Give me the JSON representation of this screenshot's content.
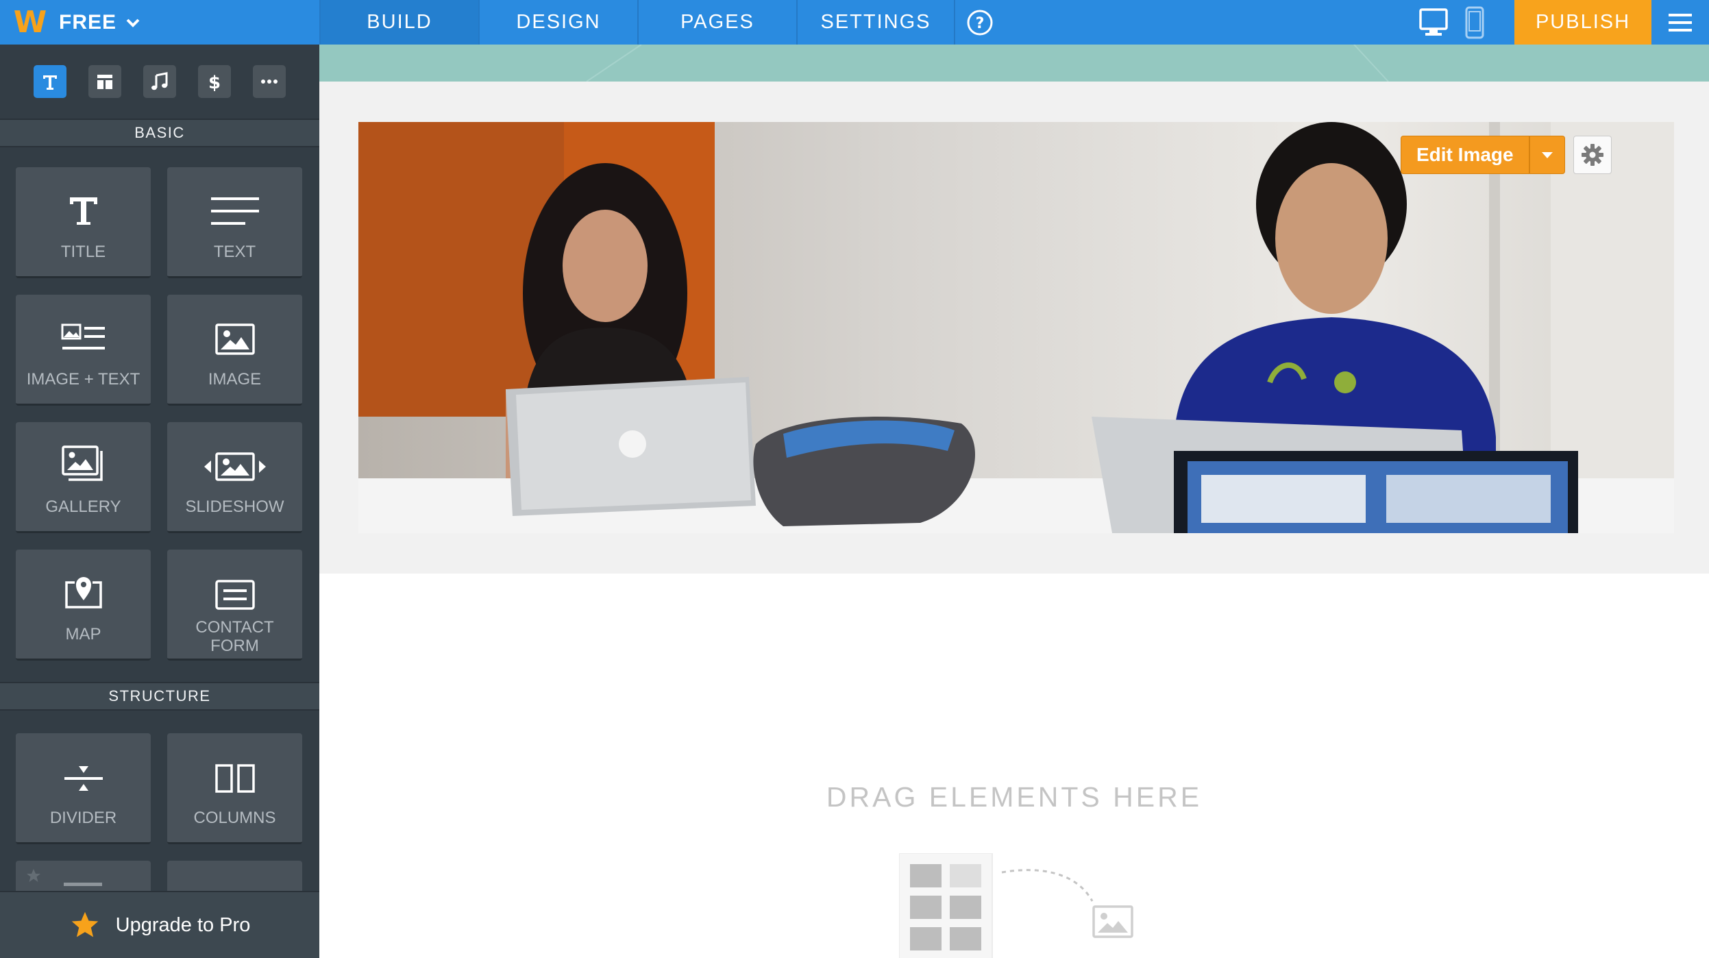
{
  "topbar": {
    "logo_letter": "W",
    "plan_label": "FREE",
    "tabs": [
      {
        "label": "BUILD",
        "active": true
      },
      {
        "label": "DESIGN",
        "active": false
      },
      {
        "label": "PAGES",
        "active": false
      },
      {
        "label": "SETTINGS",
        "active": false
      }
    ],
    "help_icon": "question-circle-icon",
    "publish_label": "PUBLISH"
  },
  "sidebar": {
    "categories": [
      "text-icon",
      "layout-icon",
      "music-icon",
      "dollar-icon",
      "more-icon"
    ],
    "basic_header": "BASIC",
    "basic_items": [
      {
        "label": "TITLE",
        "icon": "title-icon"
      },
      {
        "label": "TEXT",
        "icon": "text-lines-icon"
      },
      {
        "label": "IMAGE + TEXT",
        "icon": "image-text-icon"
      },
      {
        "label": "IMAGE",
        "icon": "image-icon"
      },
      {
        "label": "GALLERY",
        "icon": "gallery-icon"
      },
      {
        "label": "SLIDESHOW",
        "icon": "slideshow-icon"
      },
      {
        "label": "MAP",
        "icon": "map-pin-icon"
      },
      {
        "label": "CONTACT FORM",
        "icon": "contact-form-icon"
      }
    ],
    "structure_header": "STRUCTURE",
    "structure_items": [
      {
        "label": "DIVIDER",
        "icon": "divider-icon"
      },
      {
        "label": "COLUMNS",
        "icon": "columns-icon"
      }
    ],
    "upgrade_label": "Upgrade to Pro"
  },
  "canvas": {
    "edit_image_label": "Edit Image",
    "drop_text": "DRAG ELEMENTS HERE"
  },
  "colors": {
    "topbar": "#2a8be0",
    "publish": "#f8a31c",
    "sidebar": "#333d45",
    "teal_band": "#94c8c0",
    "edit_button": "#f49a1f"
  }
}
